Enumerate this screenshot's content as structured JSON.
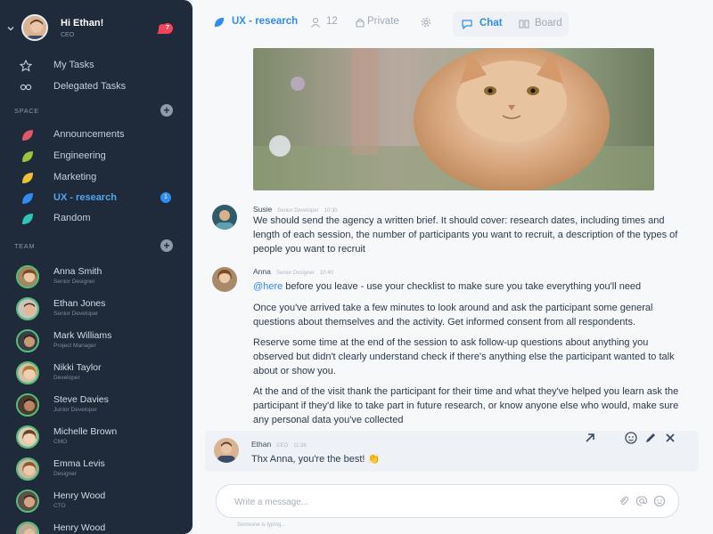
{
  "user": {
    "greeting": "Hi Ethan!",
    "role": "CEO",
    "notifications": "7"
  },
  "nav": [
    {
      "label": "My Tasks",
      "icon": "star-icon"
    },
    {
      "label": "Delegated Tasks",
      "icon": "link-icon"
    }
  ],
  "space": {
    "label": "SPACE",
    "items": [
      {
        "label": "Announcements",
        "color": "#e0566a"
      },
      {
        "label": "Engineering",
        "color": "#9bc53d"
      },
      {
        "label": "Marketing",
        "color": "#f2c12e"
      },
      {
        "label": "UX - research",
        "color": "#2f8cf0",
        "badge": "1"
      },
      {
        "label": "Random",
        "color": "#2ec4b6"
      }
    ]
  },
  "team": {
    "label": "TEAM",
    "members": [
      {
        "name": "Anna Smith",
        "role": "Senior Designer"
      },
      {
        "name": "Ethan Jones",
        "role": "Senior Developer"
      },
      {
        "name": "Mark Williams",
        "role": "Project Manager"
      },
      {
        "name": "Nikki Taylor",
        "role": "Developer"
      },
      {
        "name": "Steve Davies",
        "role": "Junior Developer"
      },
      {
        "name": "Michelle Brown",
        "role": "CMO"
      },
      {
        "name": "Emma Levis",
        "role": "Designer"
      },
      {
        "name": "Henry Wood",
        "role": "CTO"
      },
      {
        "name": "Henry Wood",
        "role": ""
      }
    ]
  },
  "channel": {
    "title": "UX - research",
    "members": "12",
    "privacy": "Private",
    "views": {
      "chat": "Chat",
      "board": "Board"
    }
  },
  "messages": [
    {
      "author": "Susie",
      "role": "Senior Developer",
      "time": "10:30",
      "paragraphs": [
        "We should send the agency a written brief. It should cover:  research dates, including times and length of each session, the number of participants you want to recruit, a description of the types of people you want to recruit"
      ]
    },
    {
      "author": "Anna",
      "role": "Senior Designer",
      "time": "10:40",
      "mention": "@here",
      "paragraphs": [
        " before you leave - use your checklist to make sure you take everything you'll need",
        "Once you've arrived take a few minutes to look around and ask the participant some general questions about themselves and the activity. Get informed consent from all respondents.",
        "Reserve some time at the end of the session to ask follow-up questions about anything you observed but didn't clearly understand check if there's anything else the participant wanted to talk about or show you.",
        "At the and of the visit thank the participant for their time and what they've helped you learn ask the participant if they'd like to take part in future research, or know anyone else who would, make sure any personal data you've collected"
      ]
    }
  ],
  "reply": {
    "author": "Ethan",
    "role": "CEO",
    "time": "11:36",
    "text": "Thx Anna, you're the best! 👏"
  },
  "composer": {
    "placeholder": "Write a message...",
    "typing": "Someone is typing..."
  }
}
